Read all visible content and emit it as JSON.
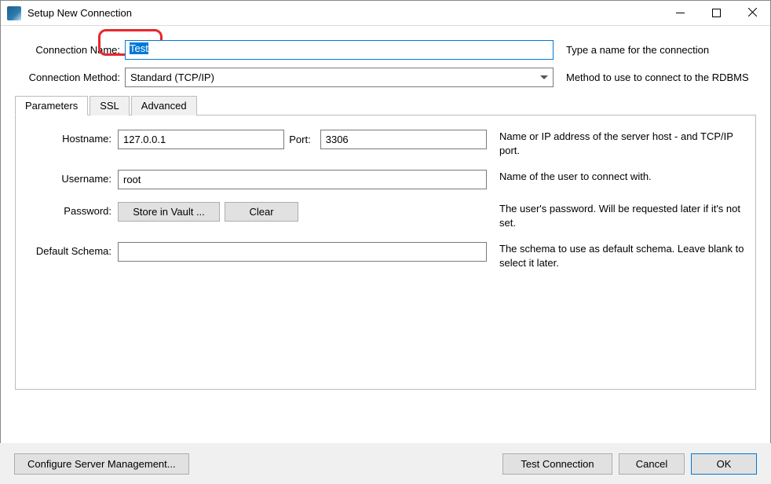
{
  "window": {
    "title": "Setup New Connection"
  },
  "topform": {
    "name_label": "Connection Name:",
    "name_value": "Test",
    "name_hint": "Type a name for the connection",
    "method_label": "Connection Method:",
    "method_value": "Standard (TCP/IP)",
    "method_hint": "Method to use to connect to the RDBMS"
  },
  "tabs": {
    "parameters": "Parameters",
    "ssl": "SSL",
    "advanced": "Advanced"
  },
  "params": {
    "hostname_label": "Hostname:",
    "hostname_value": "127.0.0.1",
    "port_label": "Port:",
    "port_value": "3306",
    "hostname_hint": "Name or IP address of the server host - and TCP/IP port.",
    "username_label": "Username:",
    "username_value": "root",
    "username_hint": "Name of the user to connect with.",
    "password_label": "Password:",
    "store_btn": "Store in Vault ...",
    "clear_btn": "Clear",
    "password_hint": "The user's password. Will be requested later if it's not set.",
    "schema_label": "Default Schema:",
    "schema_value": "",
    "schema_hint": "The schema to use as default schema. Leave blank to select it later."
  },
  "footer": {
    "configure": "Configure Server Management...",
    "test": "Test Connection",
    "cancel": "Cancel",
    "ok": "OK"
  }
}
